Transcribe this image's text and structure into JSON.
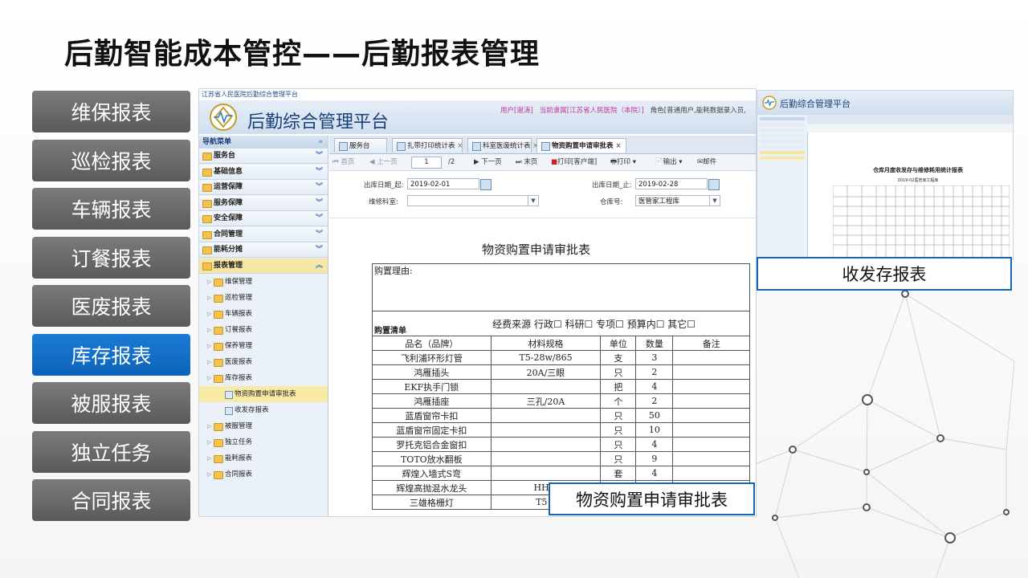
{
  "slide": {
    "title": "后勤智能成本管控——后勤报表管理"
  },
  "left_menu": [
    {
      "label": "维保报表",
      "active": false
    },
    {
      "label": "巡检报表",
      "active": false
    },
    {
      "label": "车辆报表",
      "active": false
    },
    {
      "label": "订餐报表",
      "active": false
    },
    {
      "label": "医废报表",
      "active": false
    },
    {
      "label": "库存报表",
      "active": true
    },
    {
      "label": "被服报表",
      "active": false
    },
    {
      "label": "独立任务",
      "active": false
    },
    {
      "label": "合同报表",
      "active": false
    }
  ],
  "app": {
    "window_title": "江苏省人民医院后勤综合管理平台",
    "platform_name": "后勤综合管理平台",
    "user_label": "用户[谢涛]",
    "unit_label": "当前隶属[江苏省人民医院（本院）]",
    "role_label": "角色[普通用户,能耗数据录入员,"
  },
  "nav": {
    "header": "导航菜单",
    "groups": [
      "服务台",
      "基础信息",
      "运营保障",
      "服务保障",
      "安全保障",
      "合同管理",
      "能耗分摊",
      "报表管理"
    ],
    "subs": [
      "维保管理",
      "巡检管理",
      "车辆报表",
      "订餐报表",
      "保养管理",
      "医废报表",
      "库存报表"
    ],
    "leaves": [
      "物资购置申请审批表",
      "收发存报表"
    ],
    "subs2": [
      "被服管理",
      "独立任务",
      "能耗报表",
      "合同报表"
    ]
  },
  "tabs": [
    "服务台",
    "扎带打印统计表",
    "科室医废统计表",
    "物资购置申请审批表"
  ],
  "toolbar": {
    "first": "首页",
    "prev": "上一页",
    "page": "1",
    "total": "/2",
    "next": "下一页",
    "last": "末页",
    "print_client": "打印[客户端]",
    "print": "打印",
    "export": "输出",
    "mail": "邮件"
  },
  "filters": {
    "date_from_label": "出库日期_起:",
    "date_from": "2019-02-01",
    "date_to_label": "出库日期_止:",
    "date_to": "2019-02-28",
    "dept_label": "维修科室:",
    "dept": "",
    "warehouse_label": "仓库号:",
    "warehouse": "医管家工程库"
  },
  "report": {
    "title": "物资购置申请审批表",
    "reason_label": "购置理由:",
    "list_label": "购置清单",
    "fund_label": "经费来源 行政☐ 科研☐ 专项☐ 预算内☐ 其它☐",
    "headers": [
      "品名（品牌）",
      "材料规格",
      "单位",
      "数量",
      "备注"
    ],
    "rows": [
      [
        "飞利浦环形灯管",
        "T5-28w/865",
        "支",
        "3",
        ""
      ],
      [
        "鸿雁插头",
        "20A/三眼",
        "只",
        "2",
        ""
      ],
      [
        "EKF执手门锁",
        "",
        "把",
        "4",
        ""
      ],
      [
        "鸿雁插座",
        "三孔/20A",
        "个",
        "2",
        ""
      ],
      [
        "蓝盾窗帘卡扣",
        "",
        "只",
        "50",
        ""
      ],
      [
        "蓝盾窗帘固定卡扣",
        "",
        "只",
        "10",
        ""
      ],
      [
        "罗托克铝合金窗扣",
        "",
        "只",
        "4",
        ""
      ],
      [
        "TOTO放水翻板",
        "",
        "只",
        "9",
        ""
      ],
      [
        "辉煌入墙式S弯",
        "",
        "套",
        "4",
        ""
      ],
      [
        "辉煌高抛混水龙头",
        "HH-1",
        "",
        "",
        ""
      ],
      [
        "三雄格栅灯",
        "T5 3",
        "",
        "",
        ""
      ]
    ]
  },
  "callouts": {
    "main": "物资购置申请审批表",
    "thumb": "收发存报表"
  },
  "thumbnail": {
    "platform_name": "后勤综合管理平台",
    "report_title": "仓库月度收发存与维修耗用统计报表",
    "subtitle": "2019-02医管家工程库"
  }
}
